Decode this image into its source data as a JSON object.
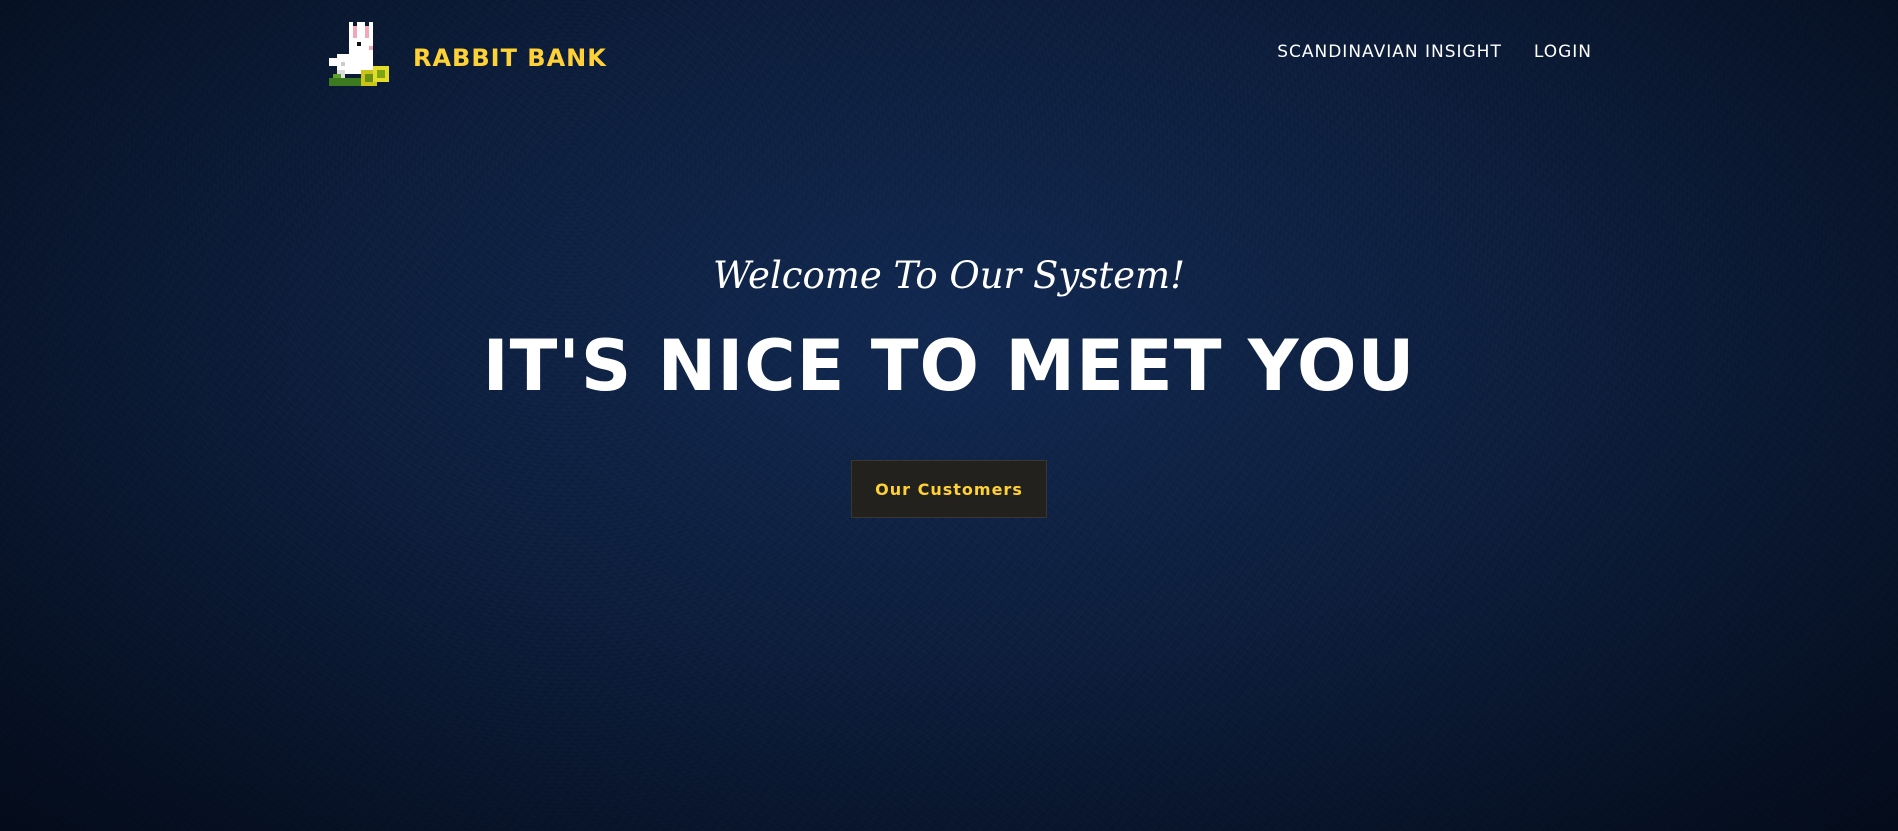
{
  "navbar": {
    "brand_name": "RABBIT BANK",
    "brand_logo_icon": "pixel-rabbit-with-coins-icon",
    "links": [
      {
        "label": "SCANDINAVIAN INSIGHT"
      },
      {
        "label": "LOGIN"
      }
    ]
  },
  "hero": {
    "lead": "Welcome To Our System!",
    "heading": "IT'S NICE TO MEET YOU",
    "button_label": "Our Customers"
  },
  "colors": {
    "accent": "#fed136",
    "background": "#0b1d3d",
    "button_bg": "#23211d",
    "text": "#ffffff"
  }
}
